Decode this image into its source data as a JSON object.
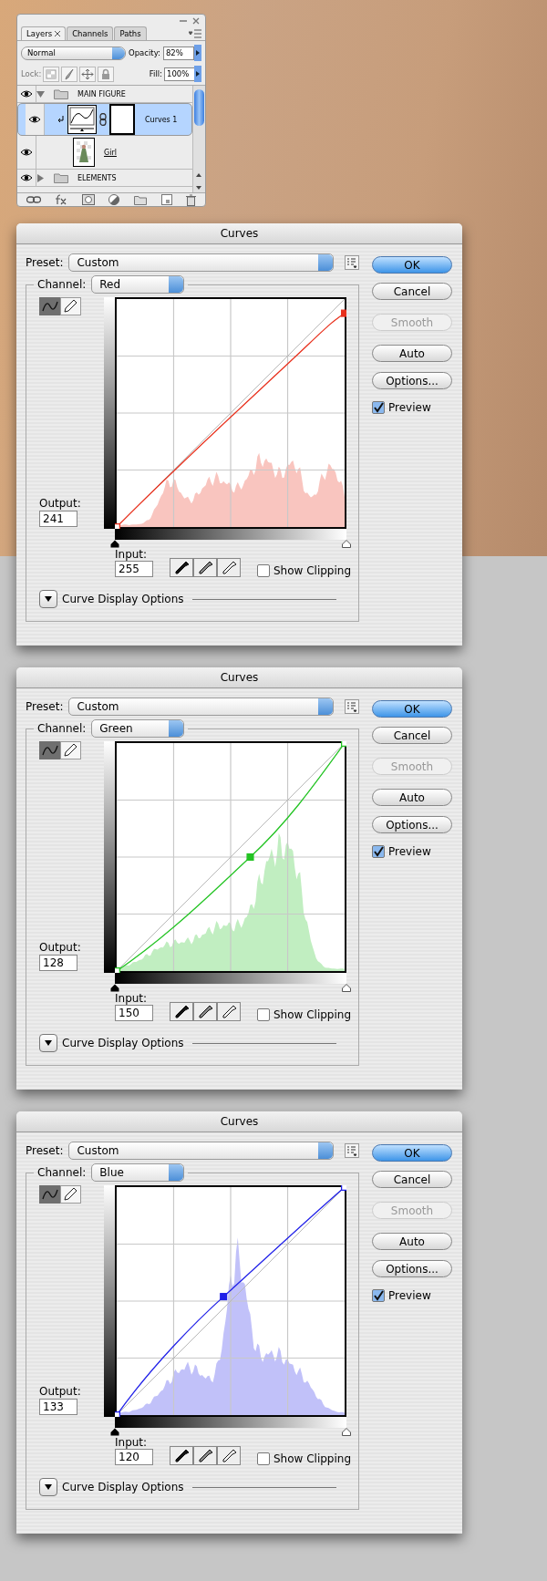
{
  "layers_panel": {
    "tabs": [
      {
        "label": "Layers",
        "selected": true
      },
      {
        "label": "Channels",
        "selected": false
      },
      {
        "label": "Paths",
        "selected": false
      }
    ],
    "blend_mode": "Normal",
    "opacity_label": "Opacity:",
    "opacity": "82%",
    "lock_label": "Lock:",
    "fill_label": "Fill:",
    "fill": "100%",
    "layers": [
      {
        "name": "MAIN FIGURE",
        "kind": "group",
        "visible": true,
        "expanded": true,
        "selected": false,
        "children": [
          {
            "name": "Curves 1",
            "kind": "adjustment",
            "visible": true,
            "selected": true
          },
          {
            "name": "Girl",
            "kind": "layer",
            "visible": true,
            "selected": false
          }
        ]
      },
      {
        "name": "ELEMENTS",
        "kind": "group",
        "visible": true,
        "expanded": false,
        "selected": false
      }
    ]
  },
  "dialogs": [
    {
      "title": "Curves",
      "preset_label": "Preset:",
      "preset": "Custom",
      "channel_label": "Channel:",
      "channel": "Red",
      "color": "#e8301c",
      "output_label": "Output:",
      "output": "241",
      "input_label": "Input:",
      "input": "255",
      "show_clipping": {
        "label": "Show Clipping",
        "checked": false
      },
      "display_options": "Curve Display Options",
      "buttons": [
        {
          "label": "OK",
          "kind": "default"
        },
        {
          "label": "Cancel",
          "kind": "normal"
        },
        {
          "label": "Smooth",
          "kind": "disabled"
        },
        {
          "label": "Auto",
          "kind": "normal"
        },
        {
          "label": "Options...",
          "kind": "normal"
        }
      ],
      "preview": {
        "label": "Preview",
        "checked": true
      }
    },
    {
      "title": "Curves",
      "preset_label": "Preset:",
      "preset": "Custom",
      "channel_label": "Channel:",
      "channel": "Green",
      "color": "#22c322",
      "output_label": "Output:",
      "output": "128",
      "input_label": "Input:",
      "input": "150",
      "show_clipping": {
        "label": "Show Clipping",
        "checked": false
      },
      "display_options": "Curve Display Options",
      "buttons": [
        {
          "label": "OK",
          "kind": "default"
        },
        {
          "label": "Cancel",
          "kind": "normal"
        },
        {
          "label": "Smooth",
          "kind": "disabled"
        },
        {
          "label": "Auto",
          "kind": "normal"
        },
        {
          "label": "Options...",
          "kind": "normal"
        }
      ],
      "preview": {
        "label": "Preview",
        "checked": true
      }
    },
    {
      "title": "Curves",
      "preset_label": "Preset:",
      "preset": "Custom",
      "channel_label": "Channel:",
      "channel": "Blue",
      "color": "#2020e8",
      "output_label": "Output:",
      "output": "133",
      "input_label": "Input:",
      "input": "120",
      "show_clipping": {
        "label": "Show Clipping",
        "checked": false
      },
      "display_options": "Curve Display Options",
      "buttons": [
        {
          "label": "OK",
          "kind": "default"
        },
        {
          "label": "Cancel",
          "kind": "normal"
        },
        {
          "label": "Smooth",
          "kind": "disabled"
        },
        {
          "label": "Auto",
          "kind": "normal"
        },
        {
          "label": "Options...",
          "kind": "normal"
        }
      ],
      "preview": {
        "label": "Preview",
        "checked": true
      }
    }
  ]
}
